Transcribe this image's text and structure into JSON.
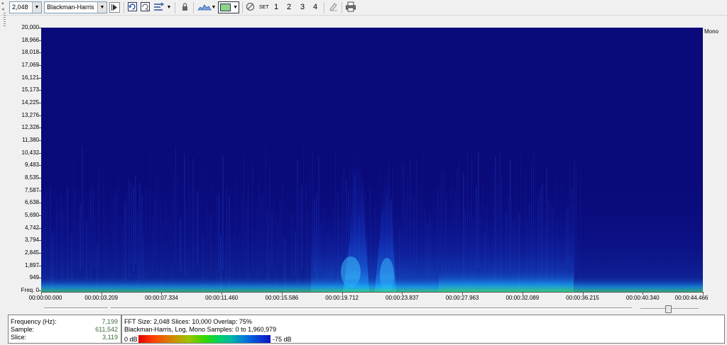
{
  "toolbar": {
    "fft_size": "2,048",
    "window_type": "Blackman-Harris",
    "set_label": "SET",
    "set_buttons": [
      "1",
      "2",
      "3",
      "4"
    ],
    "icons": [
      "play-cursor-icon",
      "refresh-icon",
      "refresh-all-icon",
      "sync-icon",
      "lock-icon",
      "spectrum-icon",
      "color-scheme-icon",
      "clear-icon",
      "eraser-icon",
      "print-icon"
    ]
  },
  "spectrogram": {
    "channel": "Mono",
    "background_color": "#0a0a7a",
    "y_labels": [
      "20,000",
      "18,966",
      "18,018",
      "17,069",
      "16,121",
      "15,173",
      "14,225",
      "13,276",
      "12,328",
      "11,380",
      "10,432",
      "9,483",
      "8,535",
      "7,587",
      "6,638",
      "5,690",
      "4,742",
      "3,794",
      "2,845",
      "1,897",
      "949",
      "Freq. 0"
    ],
    "x_labels": [
      "00:00:00.000",
      "00:00:03.209",
      "00:00:07.334",
      "00:00:11.460",
      "00:00:15.586",
      "00:00:19.712",
      "00:00:23.837",
      "00:00:27.963",
      "00:00:32.089",
      "00:00:36.215",
      "00:00:40.340",
      "00:00:44.466"
    ]
  },
  "status": {
    "frequency_label": "Frequency (Hz):",
    "frequency_value": "7,199",
    "sample_label": "Sample:",
    "sample_value": "611,542",
    "slice_label": "Slice:",
    "slice_value": "3,119",
    "info_line1": "FFT Size: 2,048  Slices: 10,000  Overlap: 75%",
    "info_line2": "Blackman-Harris, Log, Mono  Samples: 0 to 1,960,979",
    "db_low": "0 dB",
    "db_high": "-75 dB"
  }
}
